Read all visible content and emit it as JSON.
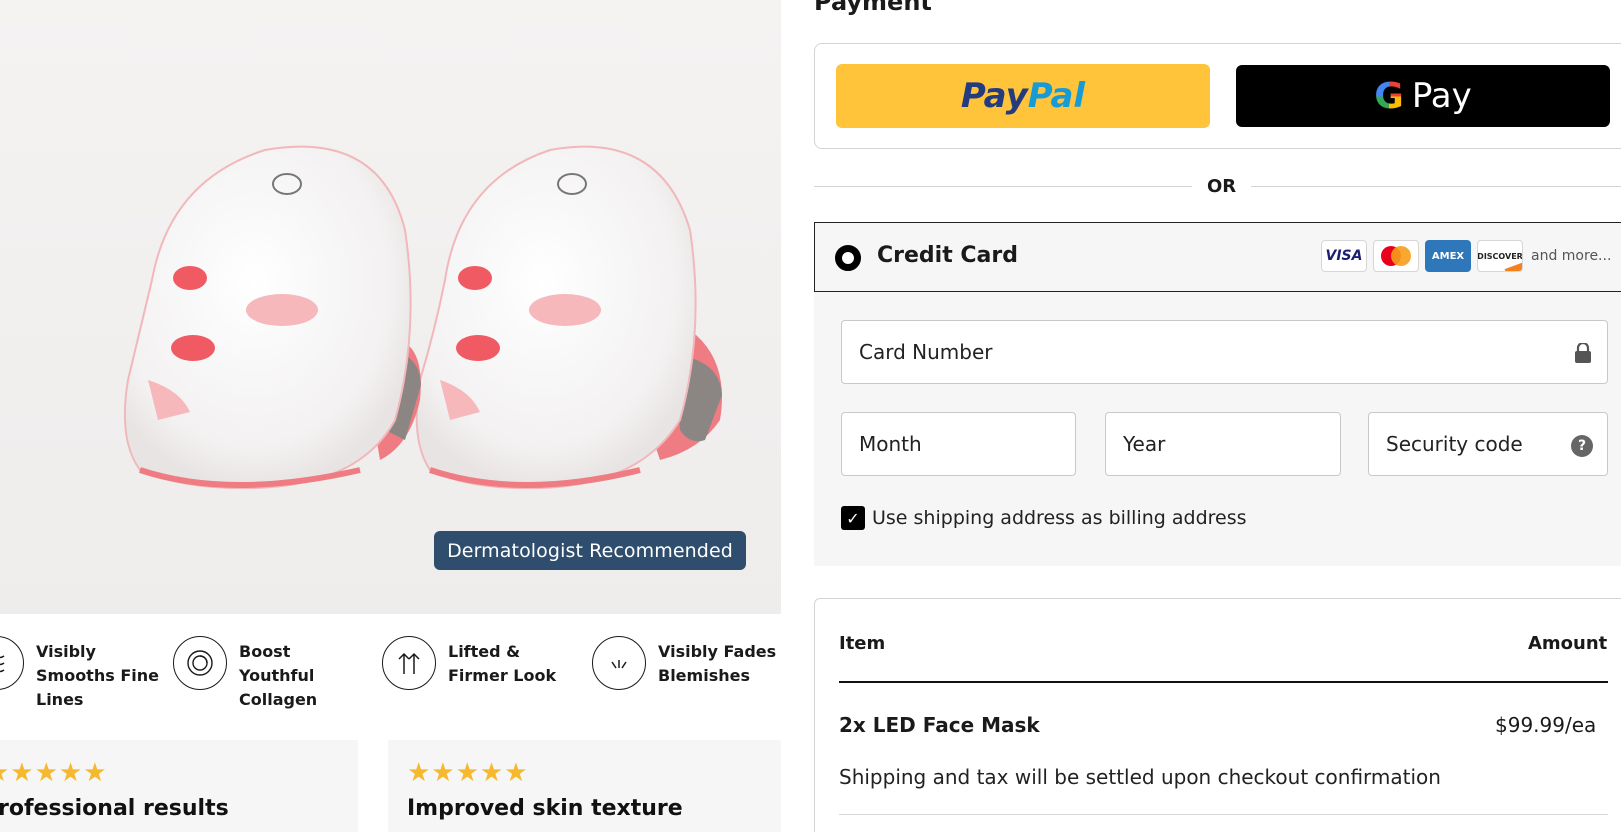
{
  "product": {
    "badge": "Dermatologist Recommended"
  },
  "benefits": [
    {
      "label": "Visibly Smooths Fine Lines",
      "icon": "wave-lines-icon"
    },
    {
      "label": "Boost Youthful Collagen",
      "icon": "spiral-icon"
    },
    {
      "label": "Lifted & Firmer Look",
      "icon": "up-arrows-icon"
    },
    {
      "label": "Visibly Fades Blemishes",
      "icon": "fade-spark-icon"
    }
  ],
  "reviews": [
    {
      "stars": "★★★★★",
      "title": "rofessional results"
    },
    {
      "stars": "★★★★★",
      "title": "Improved skin texture"
    }
  ],
  "payment": {
    "title": "Payment",
    "paypal_part1": "Pay",
    "paypal_part2": "Pal",
    "gpay_g": "G",
    "gpay_label": "Pay",
    "or_text": "OR",
    "credit_card_label": "Credit Card",
    "card_logos": [
      "VISA",
      "MASTERCARD",
      "AMEX",
      "DISCOVER"
    ],
    "and_more": "and more...",
    "card_number_placeholder": "Card Number",
    "month_placeholder": "Month",
    "year_placeholder": "Year",
    "security_code_placeholder": "Security code",
    "help_icon": "?",
    "billing_checked": true,
    "billing_label": "Use shipping address as billing address"
  },
  "summary": {
    "item_header": "Item",
    "amount_header": "Amount",
    "item_name": "2x LED Face Mask",
    "item_price": "$99.99/ea",
    "shipping_note": "Shipping and tax will be settled upon checkout confirmation"
  },
  "colors": {
    "paypal_yellow": "#ffc43a",
    "gpay_black": "#000000",
    "badge_blue": "#2f4d6d",
    "star_gold": "#f5b82e"
  }
}
